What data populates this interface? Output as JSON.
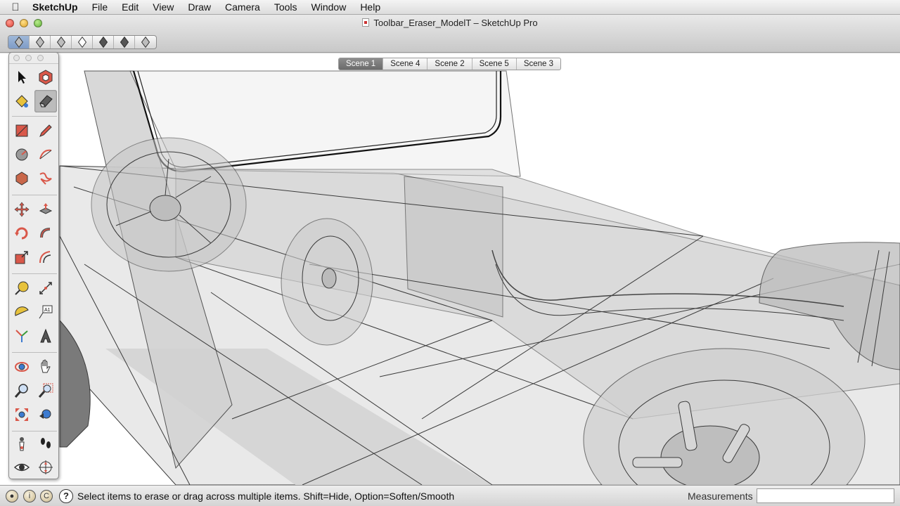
{
  "menubar": {
    "apple_icon": "apple-icon",
    "app_name": "SketchUp",
    "items": [
      "File",
      "Edit",
      "View",
      "Draw",
      "Camera",
      "Tools",
      "Window",
      "Help"
    ]
  },
  "window": {
    "title": "Toolbar_Eraser_ModelT – SketchUp Pro"
  },
  "views_toolbar": {
    "buttons": [
      "iso-view-icon",
      "top-view-icon",
      "front-view-icon",
      "right-view-icon",
      "back-view-icon",
      "left-view-icon",
      "bottom-view-icon"
    ],
    "active_index": 0
  },
  "scene_tabs": {
    "tabs": [
      "Scene 1",
      "Scene 4",
      "Scene 2",
      "Scene 5",
      "Scene 3"
    ],
    "active_index": 0
  },
  "tool_palette": {
    "selected_tool": "eraser-tool",
    "groups": [
      [
        "select-tool",
        "make-component-tool",
        "paint-bucket-tool",
        "eraser-tool"
      ],
      [
        "rectangle-tool",
        "line-tool",
        "circle-tool",
        "arc-tool",
        "polygon-tool",
        "freehand-tool"
      ],
      [
        "move-tool",
        "push-pull-tool",
        "rotate-tool",
        "follow-me-tool",
        "scale-tool",
        "offset-tool"
      ],
      [
        "tape-measure-tool",
        "dimension-tool",
        "protractor-tool",
        "text-tool",
        "axes-tool",
        "3d-text-tool"
      ],
      [
        "orbit-tool",
        "pan-tool",
        "zoom-tool",
        "zoom-window-tool",
        "zoom-extents-tool",
        "previous-view-tool"
      ],
      [
        "position-camera-tool",
        "walk-tool",
        "look-around-tool",
        "section-plane-tool"
      ]
    ]
  },
  "statusbar": {
    "status_icons": [
      "geo-location-icon",
      "credits-icon",
      "copyright-icon"
    ],
    "help_label": "?",
    "status_text": "Select items to erase or drag across multiple items. Shift=Hide, Option=Soften/Smooth",
    "measurements_label": "Measurements",
    "measurements_value": ""
  },
  "colors": {
    "viewport_bg": "#ffffff",
    "active_scene_tab": "#7a7a7a",
    "active_view_button": "#8ea9d0"
  }
}
